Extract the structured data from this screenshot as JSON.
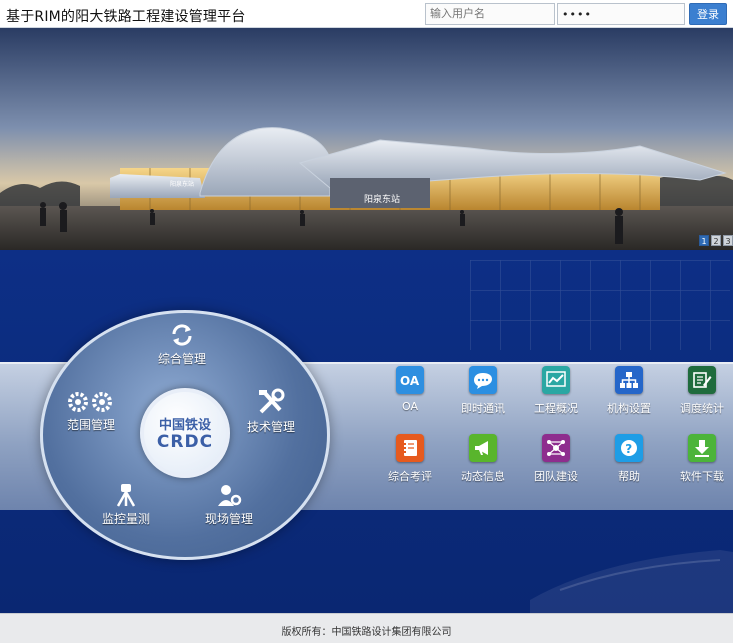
{
  "header": {
    "title": "基于RIM的阳大铁路工程建设管理平台",
    "username_placeholder": "输入用户名",
    "password_value": "1234",
    "login_label": "登录"
  },
  "banner": {
    "station_sign": "阳泉东站",
    "small_sign": "阳泉东站",
    "pages": [
      "1",
      "2",
      "3"
    ],
    "active_page": "1"
  },
  "wheel": {
    "center_cn": "中国铁设",
    "center_en": "CRDC",
    "items": [
      {
        "label": "综合管理",
        "icon": "refresh-icon"
      },
      {
        "label": "技术管理",
        "icon": "tools-icon"
      },
      {
        "label": "现场管理",
        "icon": "worker-gear-icon"
      },
      {
        "label": "监控量测",
        "icon": "survey-tripod-icon"
      },
      {
        "label": "范围管理",
        "icon": "gears-icon"
      }
    ]
  },
  "apps": [
    {
      "label": "OA",
      "icon": "oa-icon",
      "color": "#2e8fe0"
    },
    {
      "label": "即时通讯",
      "icon": "chat-icon",
      "color": "#2b8fe2"
    },
    {
      "label": "工程概况",
      "icon": "line-chart-icon",
      "color": "#2aa7a3"
    },
    {
      "label": "机构设置",
      "icon": "org-chart-icon",
      "color": "#2566c9"
    },
    {
      "label": "调度统计",
      "icon": "edit-doc-icon",
      "color": "#1f6b3d"
    },
    {
      "label": "综合考评",
      "icon": "notebook-icon",
      "color": "#e65a1e"
    },
    {
      "label": "动态信息",
      "icon": "megaphone-icon",
      "color": "#59b52c"
    },
    {
      "label": "团队建设",
      "icon": "network-icon",
      "color": "#8e2d8e"
    },
    {
      "label": "帮助",
      "icon": "help-icon",
      "color": "#1e9de6"
    },
    {
      "label": "软件下载",
      "icon": "download-icon",
      "color": "#4cb43a"
    }
  ],
  "footer": {
    "copyright": "版权所有：中国铁路设计集团有限公司"
  }
}
